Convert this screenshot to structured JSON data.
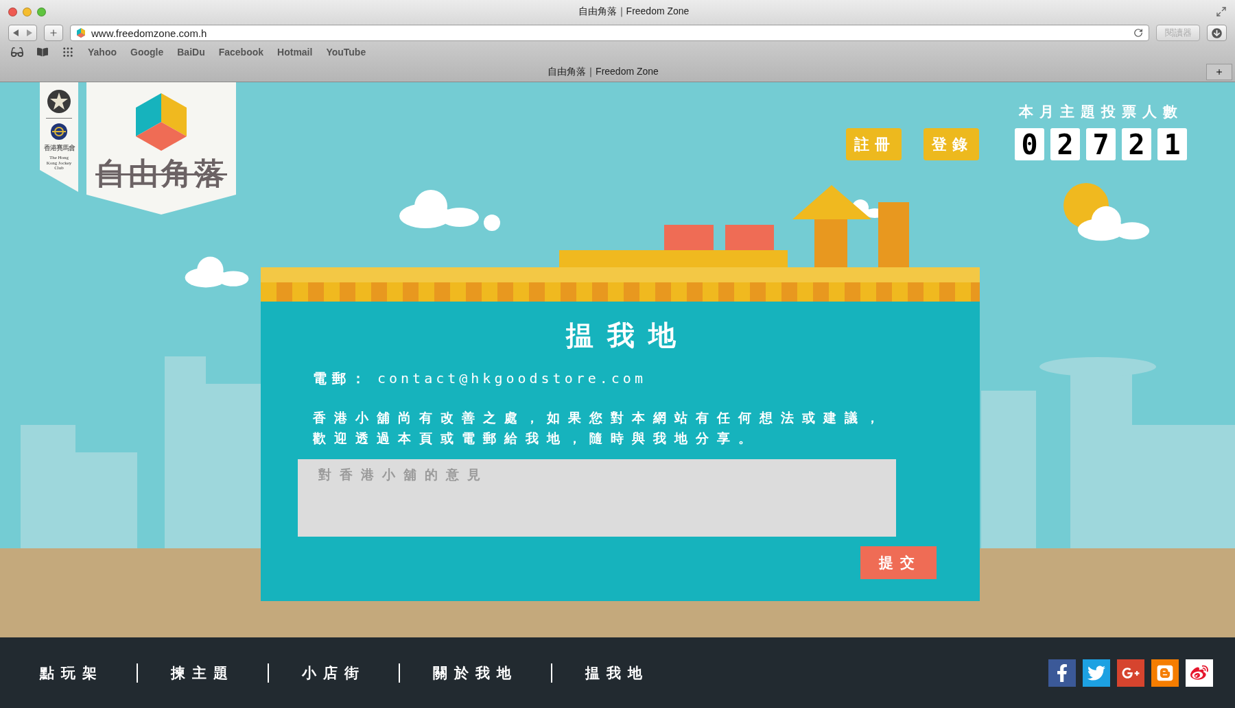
{
  "browser": {
    "title": "自由角落｜Freedom Zone",
    "url": "www.freedomzone.com.h",
    "reader_label": "閱讀器",
    "bookmarks": [
      "Yahoo",
      "Google",
      "BaiDu",
      "Facebook",
      "Hotmail",
      "YouTube"
    ],
    "tab_title": "自由角落｜Freedom Zone"
  },
  "sponsor": {
    "name_zh": "香港賽馬會",
    "name_en": "The Hong Kong Jockey Club"
  },
  "site_logo": {
    "title": "自由角落"
  },
  "auth_buttons": [
    "註冊",
    "登錄"
  ],
  "vote_counter": {
    "label": "本月主題投票人數",
    "digits": [
      "0",
      "2",
      "7",
      "2",
      "1"
    ]
  },
  "contact": {
    "title": "揾我地",
    "email_label": "電郵：",
    "email": "contact@hkgoodstore.com",
    "message_lines": [
      "香港小舖尚有改善之處，如果您對本網站有任何想法或建議，",
      "歡迎透過本頁或電郵給我地，隨時與我地分享。"
    ],
    "feedback": {
      "placeholder": "對香港小舖的意見"
    },
    "submit": "提交"
  },
  "footer_nav": [
    "點玩架",
    "揀主題",
    "小店街",
    "關於我地",
    "揾我地"
  ]
}
